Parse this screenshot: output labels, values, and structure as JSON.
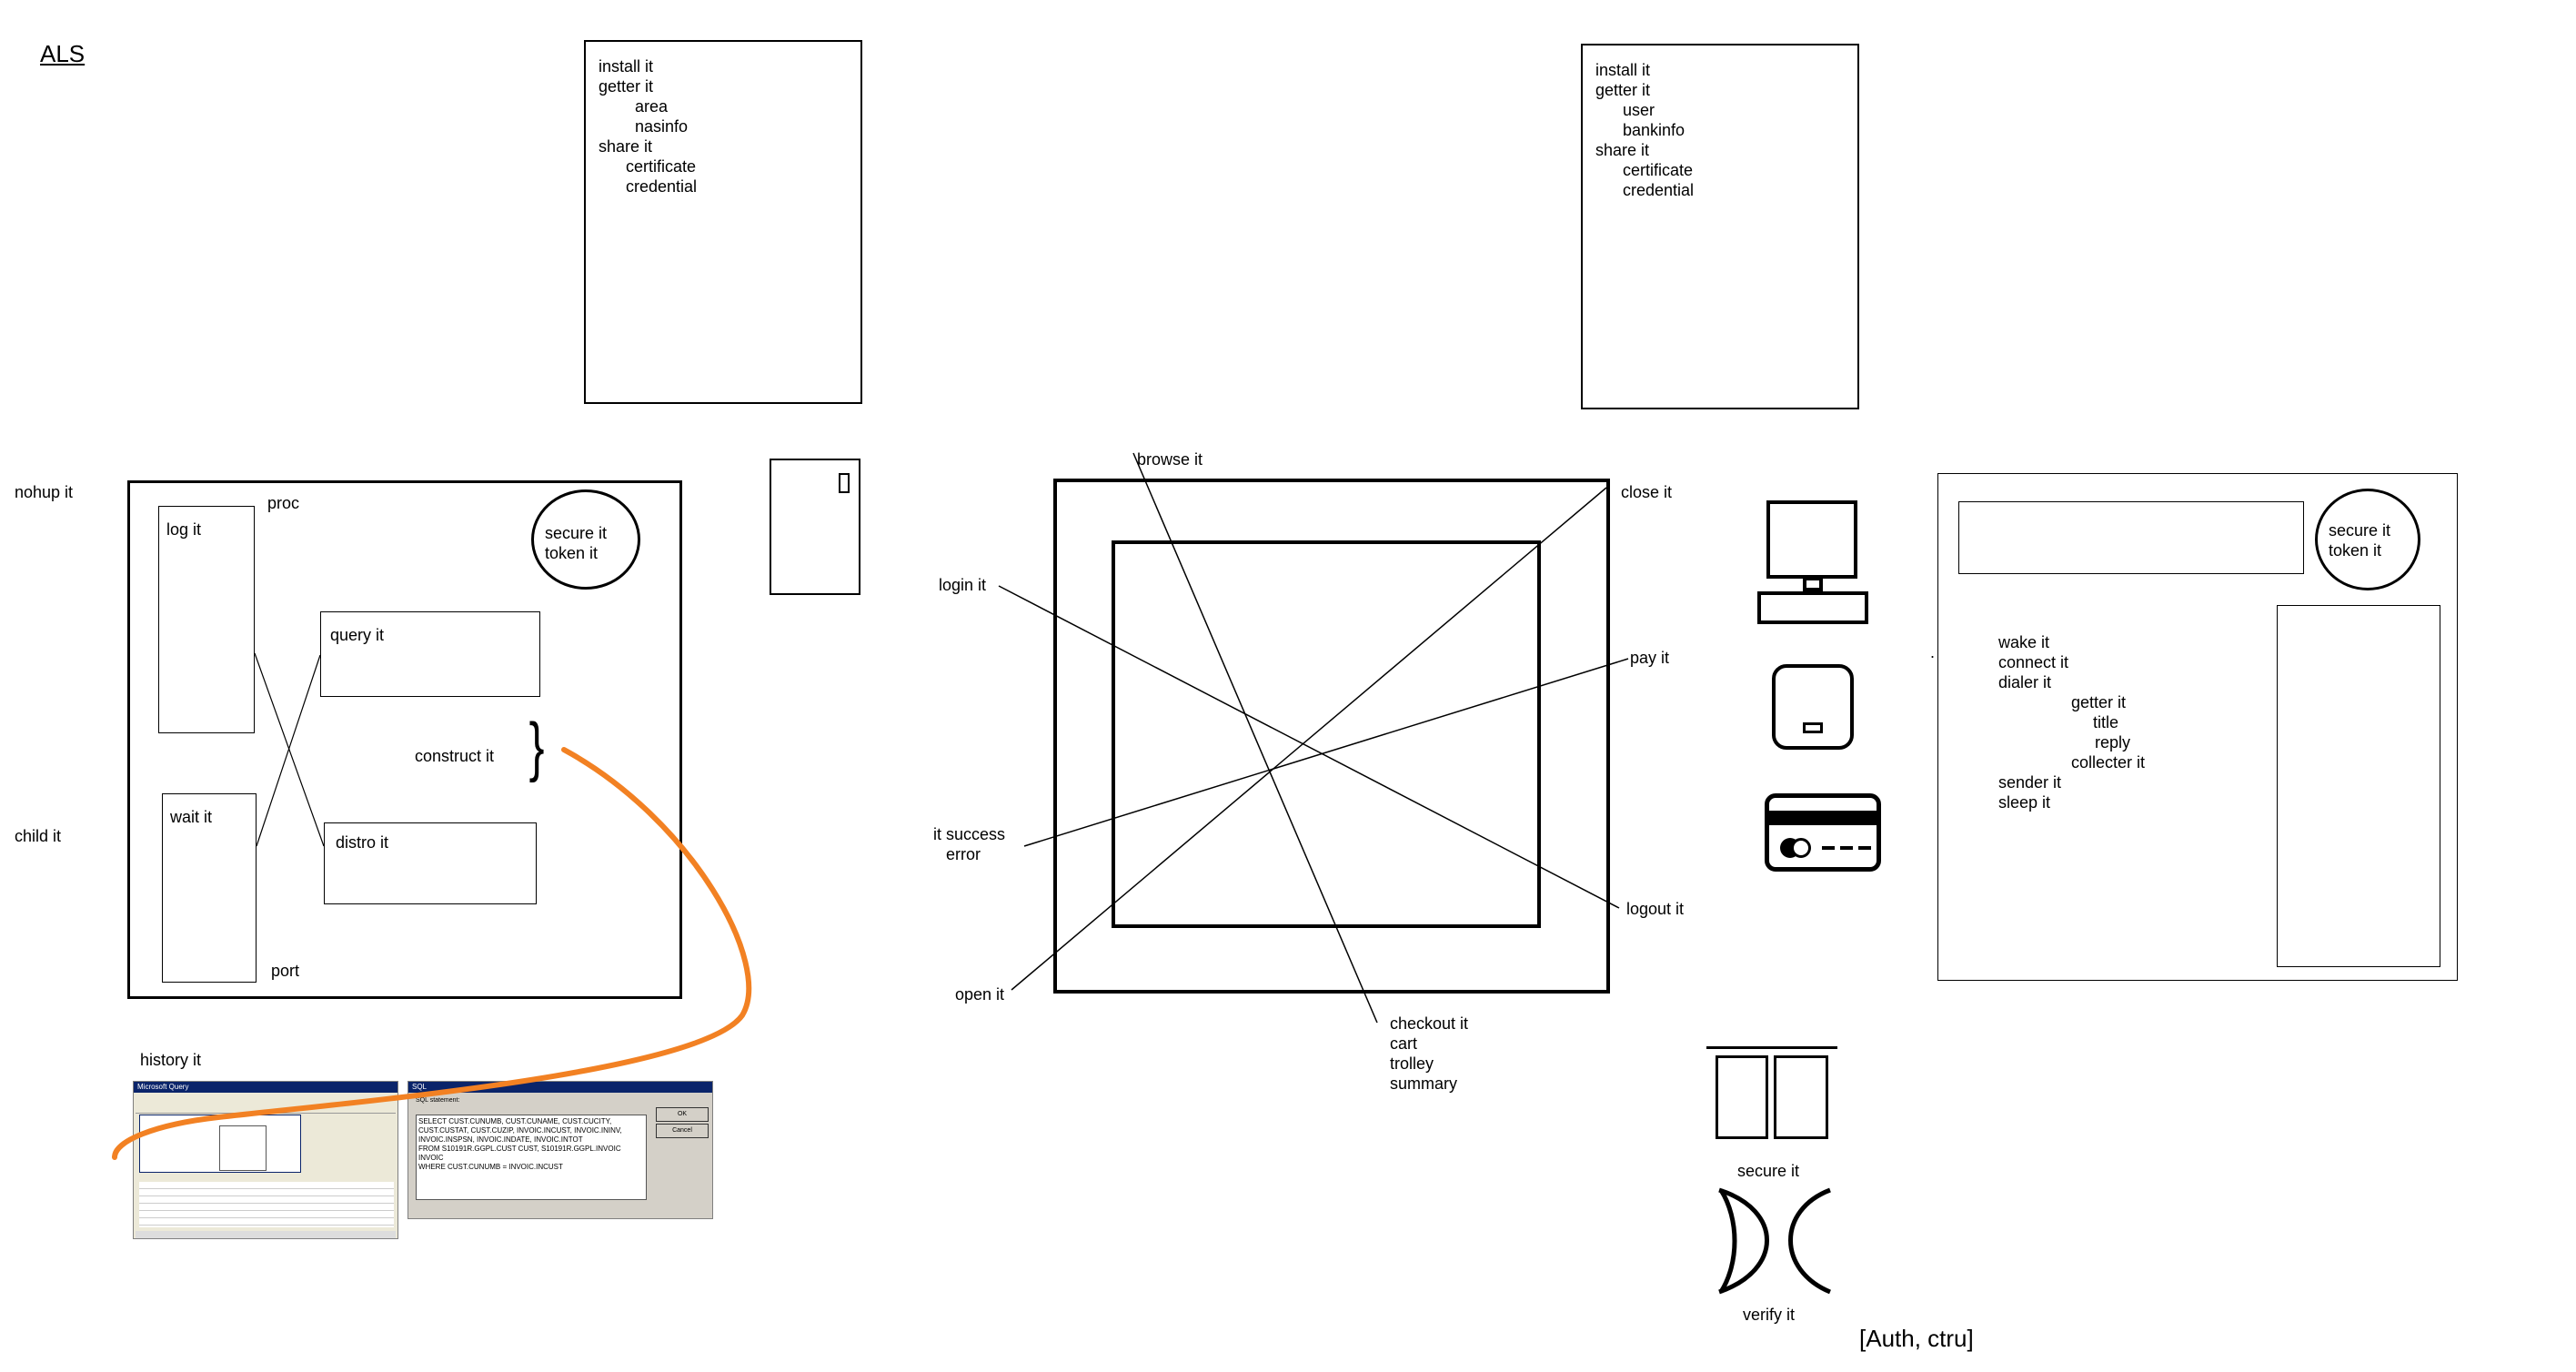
{
  "title": "ALS",
  "left_note": {
    "lines": [
      "install it",
      "getter it",
      "area",
      "nasinfo",
      "share it",
      "certificate",
      "credential"
    ]
  },
  "right_note": {
    "lines": [
      "install it",
      "getter it",
      "user",
      "bankinfo",
      "share it",
      "certificate",
      "credential"
    ]
  },
  "process_diagram": {
    "nohup_label": "nohup it",
    "child_label": "child it",
    "proc_label": "proc",
    "port_label": "port",
    "log_label": "log it",
    "wait_label": "wait it",
    "query_label": "query it",
    "distro_label": "distro it",
    "construct_label": "construct it",
    "brace": "}",
    "secure_line1": "secure it",
    "secure_line2": "token it"
  },
  "history": {
    "label": "history it",
    "query_window_title": "Microsoft Query",
    "sql_window_title": "SQL",
    "sql_caption": "SQL statement:",
    "sql_text": "SELECT CUST.CUNUMB, CUST.CUNAME, CUST.CUCITY,\nCUST.CUSTAT, CUST.CUZIP, INVOIC.INCUST, INVOIC.ININV,\nINVOIC.INSPSN, INVOIC.INDATE, INVOIC.INTOT\nFROM S10191R.GGPL.CUST CUST, S10191R.GGPL.INVOIC\nINVOIC\nWHERE CUST.CUNUMB = INVOIC.INCUST",
    "ok_label": "OK",
    "cancel_label": "Cancel"
  },
  "browser_diagram": {
    "browse": "browse it",
    "close": "close it",
    "login": "login it",
    "pay": "pay it",
    "success_line1": "it success",
    "success_line2": "error",
    "logout": "logout it",
    "open": "open it",
    "checkout_lines": [
      "checkout it",
      "cart",
      "trolley",
      "summary"
    ]
  },
  "devices": {
    "computer": "computer-icon",
    "device": "device-icon",
    "card": "credit-card-icon"
  },
  "secure_block": {
    "secure_label": "secure it",
    "verify_label": "verify it",
    "verify_dot": "."
  },
  "service_panel": {
    "secure_line1": "secure it",
    "secure_line2": "token it",
    "lines": [
      "wake it",
      "connect it",
      "dialer it",
      "getter it",
      "title",
      "reply",
      "collecter it",
      "sender it",
      "sleep it"
    ]
  },
  "auth_label": "[Auth, ctru]",
  "colors": {
    "accent_curve": "#f28123"
  }
}
